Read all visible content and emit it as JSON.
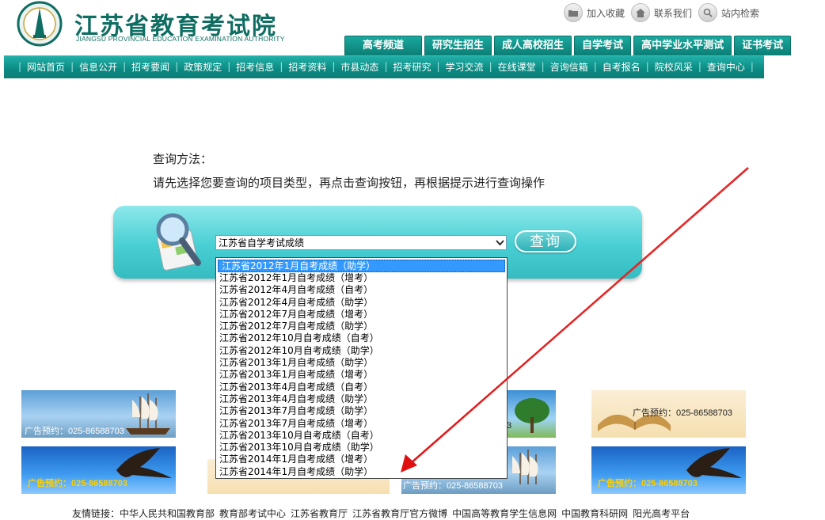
{
  "header": {
    "title_cn": "江苏省教育考试院",
    "title_en": "JIANGSU PROVINCIAL EDUCATION EXAMINATION AUTHORITY",
    "top_links": [
      "加入收藏",
      "联系我们",
      "站内检索"
    ],
    "tabs": [
      "高考频道",
      "研究生招生",
      "成人高校招生",
      "自学考试",
      "高中学业水平测试",
      "证书考试"
    ]
  },
  "nav": {
    "items": [
      "网站首页",
      "信息公开",
      "招考要闻",
      "政策规定",
      "招考信息",
      "招考资料",
      "市县动态",
      "招考研究",
      "学习交流",
      "在线课堂",
      "咨询信箱",
      "自考报名",
      "院校风采",
      "查询中心"
    ]
  },
  "main": {
    "method_title": "查询方法：",
    "method_desc": "请先选择您要查询的项目类型，再点击查询按钮，再根据提示进行查询操作",
    "select_value": "江苏省自学考试成绩",
    "query_button": "查询",
    "dropdown_options": [
      "江苏省2012年1月自考成绩（助学）",
      "江苏省2012年1月自考成绩（增考）",
      "江苏省2012年4月自考成绩（自考）",
      "江苏省2012年4月自考成绩（助学）",
      "江苏省2012年7月自考成绩（增考）",
      "江苏省2012年7月自考成绩（助学）",
      "江苏省2012年10月自考成绩（自考）",
      "江苏省2012年10月自考成绩（助学）",
      "江苏省2013年1月自考成绩（助学）",
      "江苏省2013年1月自考成绩（增考）",
      "江苏省2013年4月自考成绩（自考）",
      "江苏省2013年4月自考成绩（助学）",
      "江苏省2013年7月自考成绩（助学）",
      "江苏省2013年7月自考成绩（增考）",
      "江苏省2013年10月自考成绩（自考）",
      "江苏省2013年10月自考成绩（助学）",
      "江苏省2014年1月自考成绩（增考）",
      "江苏省2014年1月自考成绩（助学）"
    ],
    "selected_index": 0
  },
  "ads": {
    "text": "广告预约：025-86588703",
    "partial_text": "3"
  },
  "footer": {
    "label": "友情链接：",
    "links": [
      "中华人民共和国教育部",
      "教育部考试中心",
      "江苏省教育厅",
      "江苏省教育厅官方微博",
      "中国高等教育学生信息网",
      "中国教育科研网",
      "阳光高考平台"
    ]
  },
  "colors": {
    "brand": "#0f6d62",
    "nav": "#0b8a82",
    "panel": "#47cfd3",
    "selection": "#3399ff",
    "arrow": "#e01010"
  }
}
